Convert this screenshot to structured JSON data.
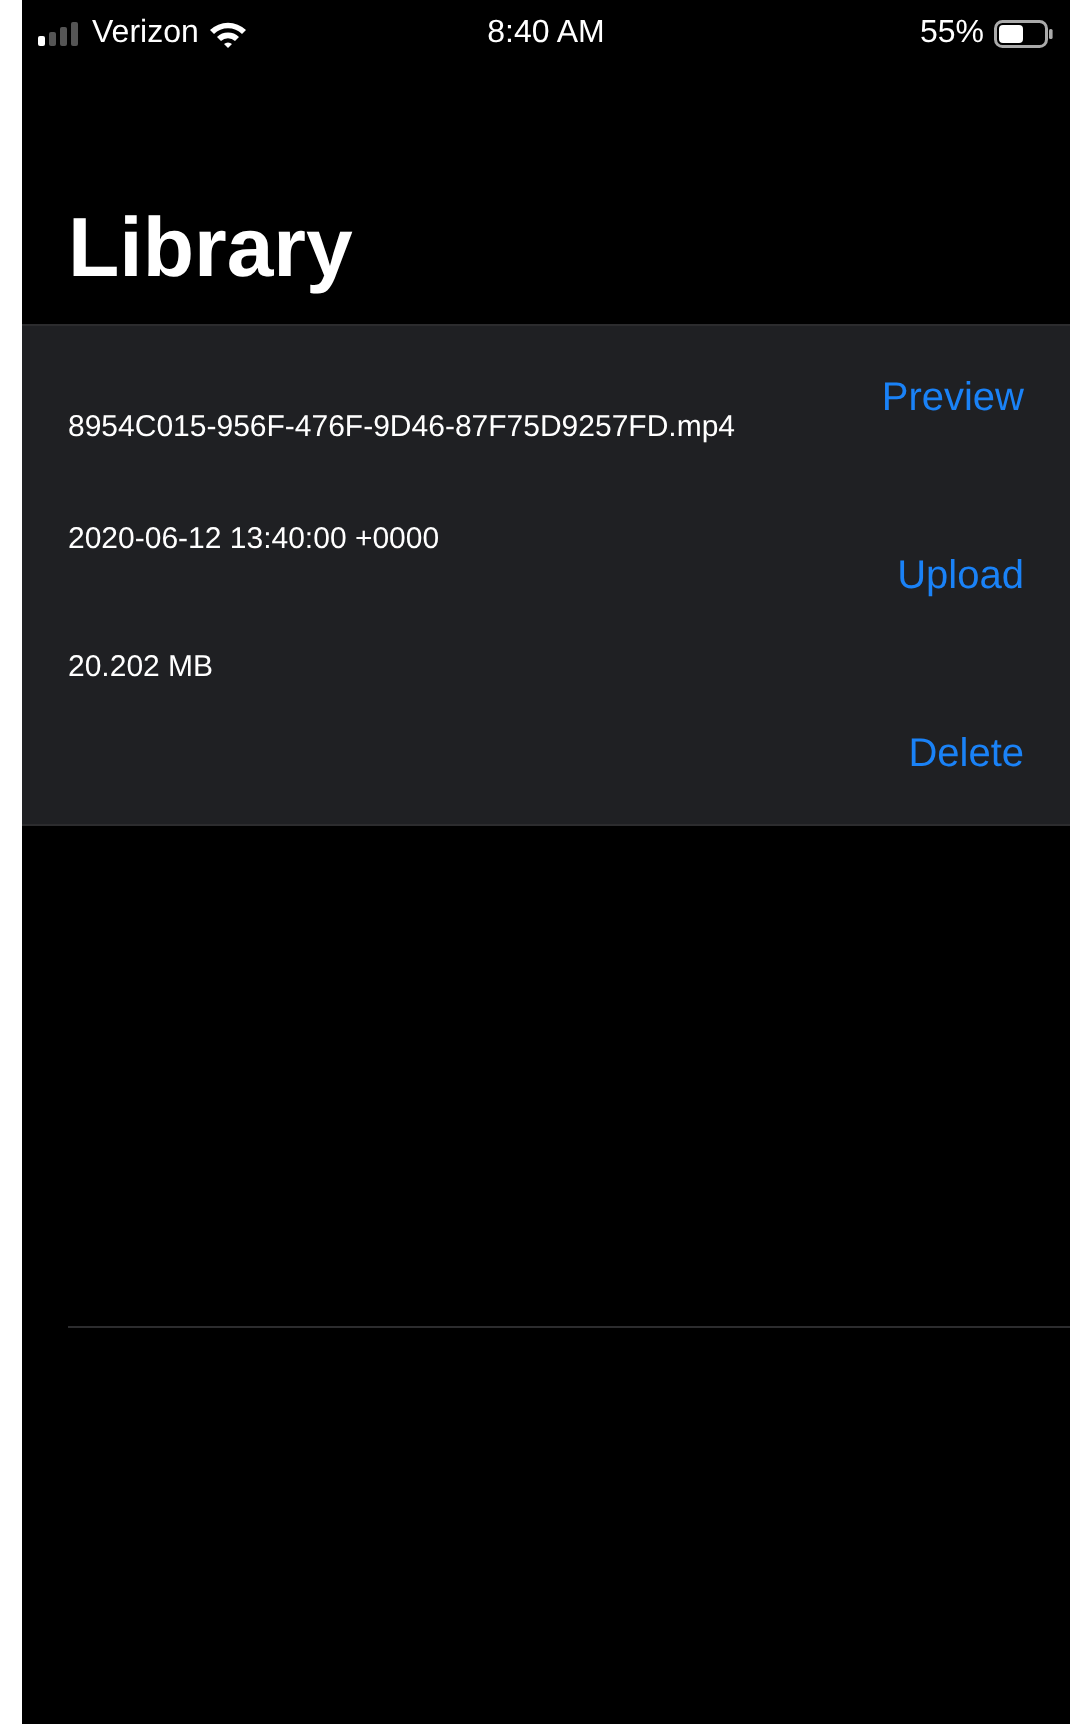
{
  "status_bar": {
    "carrier": "Verizon",
    "time": "8:40 AM",
    "battery": "55%"
  },
  "title": "Library",
  "videos": [
    {
      "name": "8954C015-956F-476F-9D46-87F75D9257FD.mp4",
      "date": "2020-06-12 13:40:00 +0000",
      "size": "20.202 MB",
      "actions": [
        "Preview",
        "Upload",
        "Delete"
      ]
    }
  ]
}
